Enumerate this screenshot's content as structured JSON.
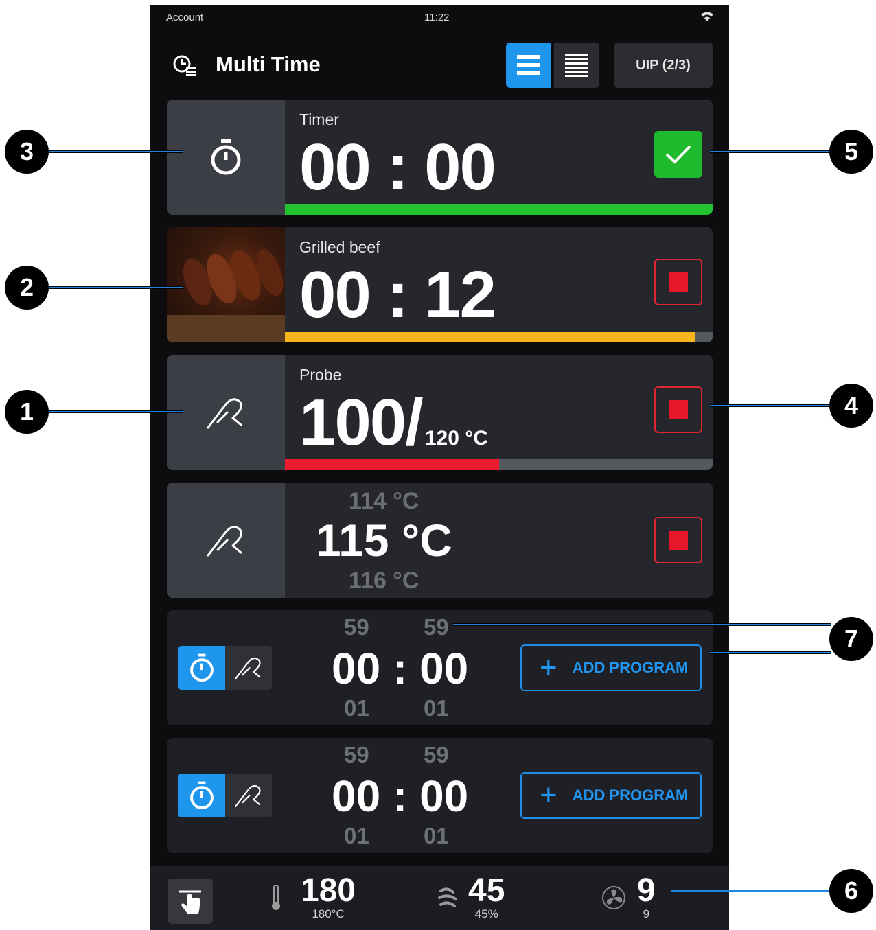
{
  "status_bar": {
    "account": "Account",
    "time": "11:22"
  },
  "header": {
    "title": "Multi Time",
    "uip_label": "UIP (2/3)"
  },
  "cards": {
    "timer": {
      "label": "Timer",
      "value": "00 : 00",
      "progress": 1.0,
      "state": "done"
    },
    "grilled": {
      "label": "Grilled beef",
      "value": "00 : 12",
      "progress": 0.96,
      "state": "running"
    },
    "probe": {
      "label": "Probe",
      "current": "100/",
      "target": "120 °C",
      "progress": 0.5,
      "state": "running"
    },
    "probe_picker": {
      "above": "114 °C",
      "value": "115 °C",
      "below": "116 °C"
    },
    "empty1": {
      "min_above": "59",
      "sec_above": "59",
      "value": "00 : 00",
      "min_below": "01",
      "sec_below": "01",
      "add_label": "ADD PROGRAM"
    },
    "empty2": {
      "min_above": "59",
      "sec_above": "59",
      "value": "00 : 00",
      "min_below": "01",
      "sec_below": "01",
      "add_label": "ADD PROGRAM"
    }
  },
  "bottom_bar": {
    "temperature": {
      "value": "180",
      "sub": "180°C"
    },
    "humidity": {
      "value": "45",
      "sub": "45%"
    },
    "fan": {
      "value": "9",
      "sub": "9"
    }
  },
  "callouts": {
    "c1": "1",
    "c2": "2",
    "c3": "3",
    "c4": "4",
    "c5": "5",
    "c6": "6",
    "c7": "7"
  },
  "colors": {
    "accent": "#1e96ee",
    "done": "#1fba2d",
    "progress_timer": "#23c22f",
    "progress_grilled": "#f6b61b",
    "progress_probe": "#ec1c2e",
    "stop": "#e8162a"
  }
}
